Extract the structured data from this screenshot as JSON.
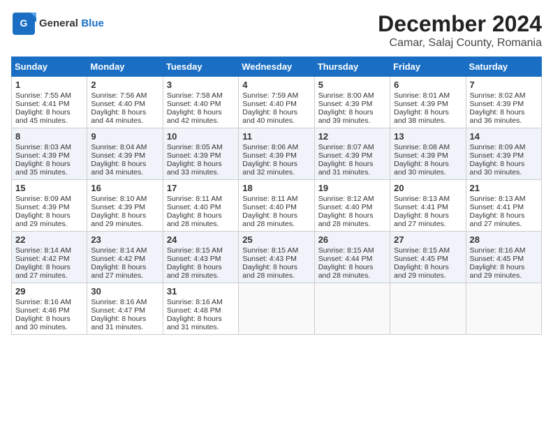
{
  "logo": {
    "general": "General",
    "blue": "Blue"
  },
  "title": "December 2024",
  "subtitle": "Camar, Salaj County, Romania",
  "weekdays": [
    "Sunday",
    "Monday",
    "Tuesday",
    "Wednesday",
    "Thursday",
    "Friday",
    "Saturday"
  ],
  "weeks": [
    [
      {
        "day": "1",
        "sunrise": "7:55 AM",
        "sunset": "4:41 PM",
        "daylight": "8 hours and 45 minutes."
      },
      {
        "day": "2",
        "sunrise": "7:56 AM",
        "sunset": "4:40 PM",
        "daylight": "8 hours and 44 minutes."
      },
      {
        "day": "3",
        "sunrise": "7:58 AM",
        "sunset": "4:40 PM",
        "daylight": "8 hours and 42 minutes."
      },
      {
        "day": "4",
        "sunrise": "7:59 AM",
        "sunset": "4:40 PM",
        "daylight": "8 hours and 40 minutes."
      },
      {
        "day": "5",
        "sunrise": "8:00 AM",
        "sunset": "4:39 PM",
        "daylight": "8 hours and 39 minutes."
      },
      {
        "day": "6",
        "sunrise": "8:01 AM",
        "sunset": "4:39 PM",
        "daylight": "8 hours and 38 minutes."
      },
      {
        "day": "7",
        "sunrise": "8:02 AM",
        "sunset": "4:39 PM",
        "daylight": "8 hours and 36 minutes."
      }
    ],
    [
      {
        "day": "8",
        "sunrise": "8:03 AM",
        "sunset": "4:39 PM",
        "daylight": "8 hours and 35 minutes."
      },
      {
        "day": "9",
        "sunrise": "8:04 AM",
        "sunset": "4:39 PM",
        "daylight": "8 hours and 34 minutes."
      },
      {
        "day": "10",
        "sunrise": "8:05 AM",
        "sunset": "4:39 PM",
        "daylight": "8 hours and 33 minutes."
      },
      {
        "day": "11",
        "sunrise": "8:06 AM",
        "sunset": "4:39 PM",
        "daylight": "8 hours and 32 minutes."
      },
      {
        "day": "12",
        "sunrise": "8:07 AM",
        "sunset": "4:39 PM",
        "daylight": "8 hours and 31 minutes."
      },
      {
        "day": "13",
        "sunrise": "8:08 AM",
        "sunset": "4:39 PM",
        "daylight": "8 hours and 30 minutes."
      },
      {
        "day": "14",
        "sunrise": "8:09 AM",
        "sunset": "4:39 PM",
        "daylight": "8 hours and 30 minutes."
      }
    ],
    [
      {
        "day": "15",
        "sunrise": "8:09 AM",
        "sunset": "4:39 PM",
        "daylight": "8 hours and 29 minutes."
      },
      {
        "day": "16",
        "sunrise": "8:10 AM",
        "sunset": "4:39 PM",
        "daylight": "8 hours and 29 minutes."
      },
      {
        "day": "17",
        "sunrise": "8:11 AM",
        "sunset": "4:40 PM",
        "daylight": "8 hours and 28 minutes."
      },
      {
        "day": "18",
        "sunrise": "8:11 AM",
        "sunset": "4:40 PM",
        "daylight": "8 hours and 28 minutes."
      },
      {
        "day": "19",
        "sunrise": "8:12 AM",
        "sunset": "4:40 PM",
        "daylight": "8 hours and 28 minutes."
      },
      {
        "day": "20",
        "sunrise": "8:13 AM",
        "sunset": "4:41 PM",
        "daylight": "8 hours and 27 minutes."
      },
      {
        "day": "21",
        "sunrise": "8:13 AM",
        "sunset": "4:41 PM",
        "daylight": "8 hours and 27 minutes."
      }
    ],
    [
      {
        "day": "22",
        "sunrise": "8:14 AM",
        "sunset": "4:42 PM",
        "daylight": "8 hours and 27 minutes."
      },
      {
        "day": "23",
        "sunrise": "8:14 AM",
        "sunset": "4:42 PM",
        "daylight": "8 hours and 27 minutes."
      },
      {
        "day": "24",
        "sunrise": "8:15 AM",
        "sunset": "4:43 PM",
        "daylight": "8 hours and 28 minutes."
      },
      {
        "day": "25",
        "sunrise": "8:15 AM",
        "sunset": "4:43 PM",
        "daylight": "8 hours and 28 minutes."
      },
      {
        "day": "26",
        "sunrise": "8:15 AM",
        "sunset": "4:44 PM",
        "daylight": "8 hours and 28 minutes."
      },
      {
        "day": "27",
        "sunrise": "8:15 AM",
        "sunset": "4:45 PM",
        "daylight": "8 hours and 29 minutes."
      },
      {
        "day": "28",
        "sunrise": "8:16 AM",
        "sunset": "4:45 PM",
        "daylight": "8 hours and 29 minutes."
      }
    ],
    [
      {
        "day": "29",
        "sunrise": "8:16 AM",
        "sunset": "4:46 PM",
        "daylight": "8 hours and 30 minutes."
      },
      {
        "day": "30",
        "sunrise": "8:16 AM",
        "sunset": "4:47 PM",
        "daylight": "8 hours and 31 minutes."
      },
      {
        "day": "31",
        "sunrise": "8:16 AM",
        "sunset": "4:48 PM",
        "daylight": "8 hours and 31 minutes."
      },
      null,
      null,
      null,
      null
    ]
  ]
}
